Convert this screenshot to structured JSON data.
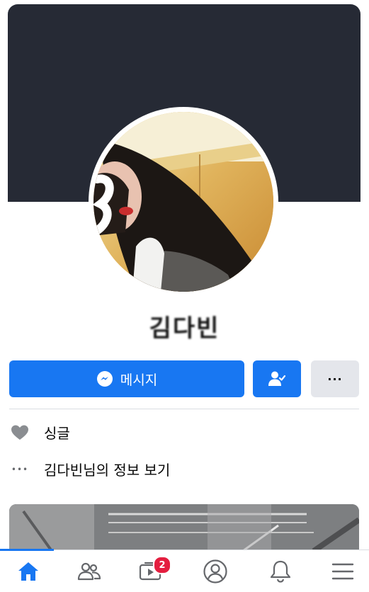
{
  "profile": {
    "name": "김다빈"
  },
  "actions": {
    "message_label": "메시지",
    "more_label": "···"
  },
  "intro": {
    "relationship": "싱글",
    "about_link": "김다빈님의 정보 보기",
    "about_icon_glyph": "•••"
  },
  "tabbar": {
    "watch_badge": "2",
    "active_tab": "home"
  },
  "colors": {
    "accent": "#1877f2",
    "cover": "#262a35",
    "badge": "#e41e3f",
    "secondary_button": "#e4e6eb"
  },
  "icons": {
    "message": "messenger-icon",
    "friend": "friend-check-icon",
    "relationship": "heart-icon",
    "tabs": [
      "home-icon",
      "friends-icon",
      "watch-icon",
      "profile-icon",
      "bell-icon",
      "menu-icon"
    ]
  }
}
